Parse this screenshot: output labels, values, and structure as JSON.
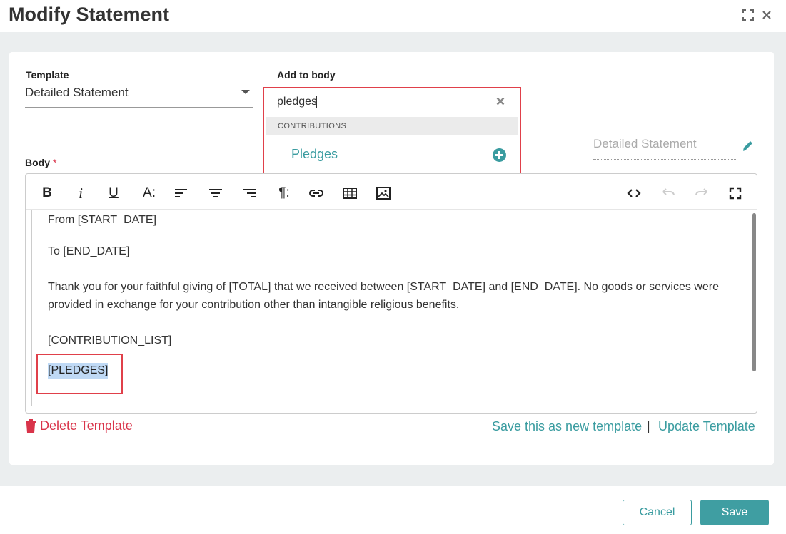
{
  "dialog": {
    "title": "Modify Statement"
  },
  "template": {
    "label": "Template",
    "value": "Detailed Statement"
  },
  "add_to_body": {
    "label": "Add to body",
    "query": "pledges",
    "group_header": "CONTRIBUTIONS",
    "option": "Pledges"
  },
  "statement_name": "Detailed Statement",
  "body": {
    "label": "Body",
    "required_mark": "*",
    "paragraphs": [
      "From [START_DATE]",
      "To [END_DATE]",
      "Thank you for your faithful giving of [TOTAL] that we received between [START_DATE] and [END_DATE]. No goods or services were provided in exchange for your contribution other than intangible religious benefits.",
      "[CONTRIBUTION_LIST]"
    ],
    "selected_token": "[PLEDGES]"
  },
  "toolbar": {
    "bold": "B",
    "italic": "i",
    "underline": "U",
    "font_size": "A:",
    "paragraph": "¶:"
  },
  "links": {
    "delete_template": "Delete Template",
    "save_new": "Save this as new template",
    "separator": "|",
    "update_template": "Update Template"
  },
  "footer": {
    "cancel": "Cancel",
    "save": "Save"
  },
  "colors": {
    "accent": "#3a9ca0",
    "danger": "#d9344a",
    "highlight_border": "#e0404a",
    "selection": "#bfd9f5"
  },
  "icons": [
    "expand-icon",
    "close-icon",
    "clear-icon",
    "add-circle-icon",
    "pencil-icon",
    "trash-icon",
    "align-left-icon",
    "align-center-icon",
    "align-right-icon",
    "link-icon",
    "table-icon",
    "image-icon",
    "code-view-icon",
    "undo-icon",
    "redo-icon",
    "fullscreen-icon"
  ]
}
